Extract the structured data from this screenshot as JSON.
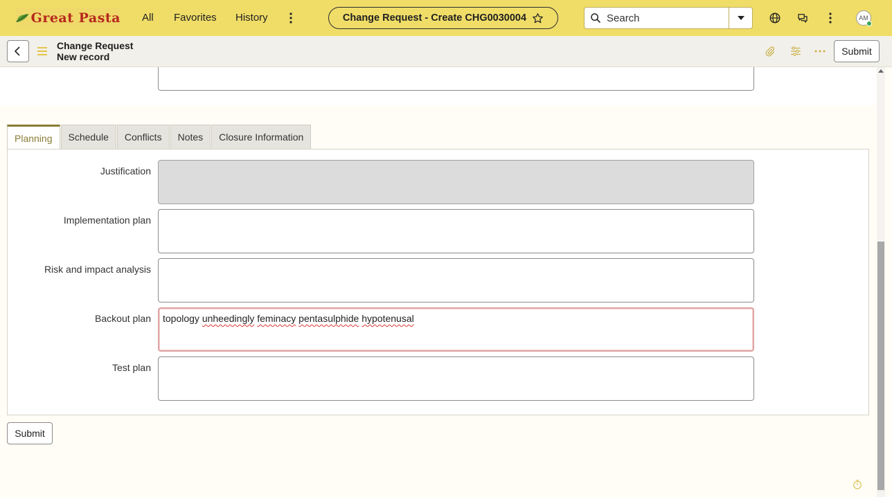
{
  "brand": {
    "name": "Great Pasta"
  },
  "nav": {
    "all": "All",
    "favorites": "Favorites",
    "history": "History"
  },
  "record_pill": {
    "title": "Change Request - Create CHG0030004"
  },
  "search": {
    "placeholder": "Search"
  },
  "user": {
    "initials": "AM"
  },
  "record_header": {
    "line1": "Change Request",
    "line2": "New record",
    "submit_label": "Submit"
  },
  "tabs": [
    {
      "label": "Planning",
      "active": true
    },
    {
      "label": "Schedule",
      "active": false
    },
    {
      "label": "Conflicts",
      "active": false
    },
    {
      "label": "Notes",
      "active": false
    },
    {
      "label": "Closure Information",
      "active": false
    }
  ],
  "fields": {
    "justification": {
      "label": "Justification",
      "value": ""
    },
    "implementation_plan": {
      "label": "Implementation plan",
      "value": ""
    },
    "risk_impact": {
      "label": "Risk and impact analysis",
      "value": ""
    },
    "backout_plan": {
      "label": "Backout plan",
      "words": [
        "topology",
        "unheedingly",
        "feminacy",
        "pentasulphide",
        "hypotenusal"
      ]
    },
    "test_plan": {
      "label": "Test plan",
      "value": ""
    }
  },
  "footer": {
    "submit_label": "Submit"
  },
  "colors": {
    "topbar": "#f0dd68",
    "brand_red": "#b5271d",
    "active_tab": "#8a7b35",
    "error_border": "#e0a3a3"
  },
  "icons": [
    "search-icon",
    "star-icon",
    "globe-icon",
    "chat-icon",
    "more-vertical-icon",
    "back-chevron-icon",
    "menu-icon",
    "paperclip-icon",
    "sliders-icon",
    "more-horizontal-icon",
    "timer-icon"
  ]
}
